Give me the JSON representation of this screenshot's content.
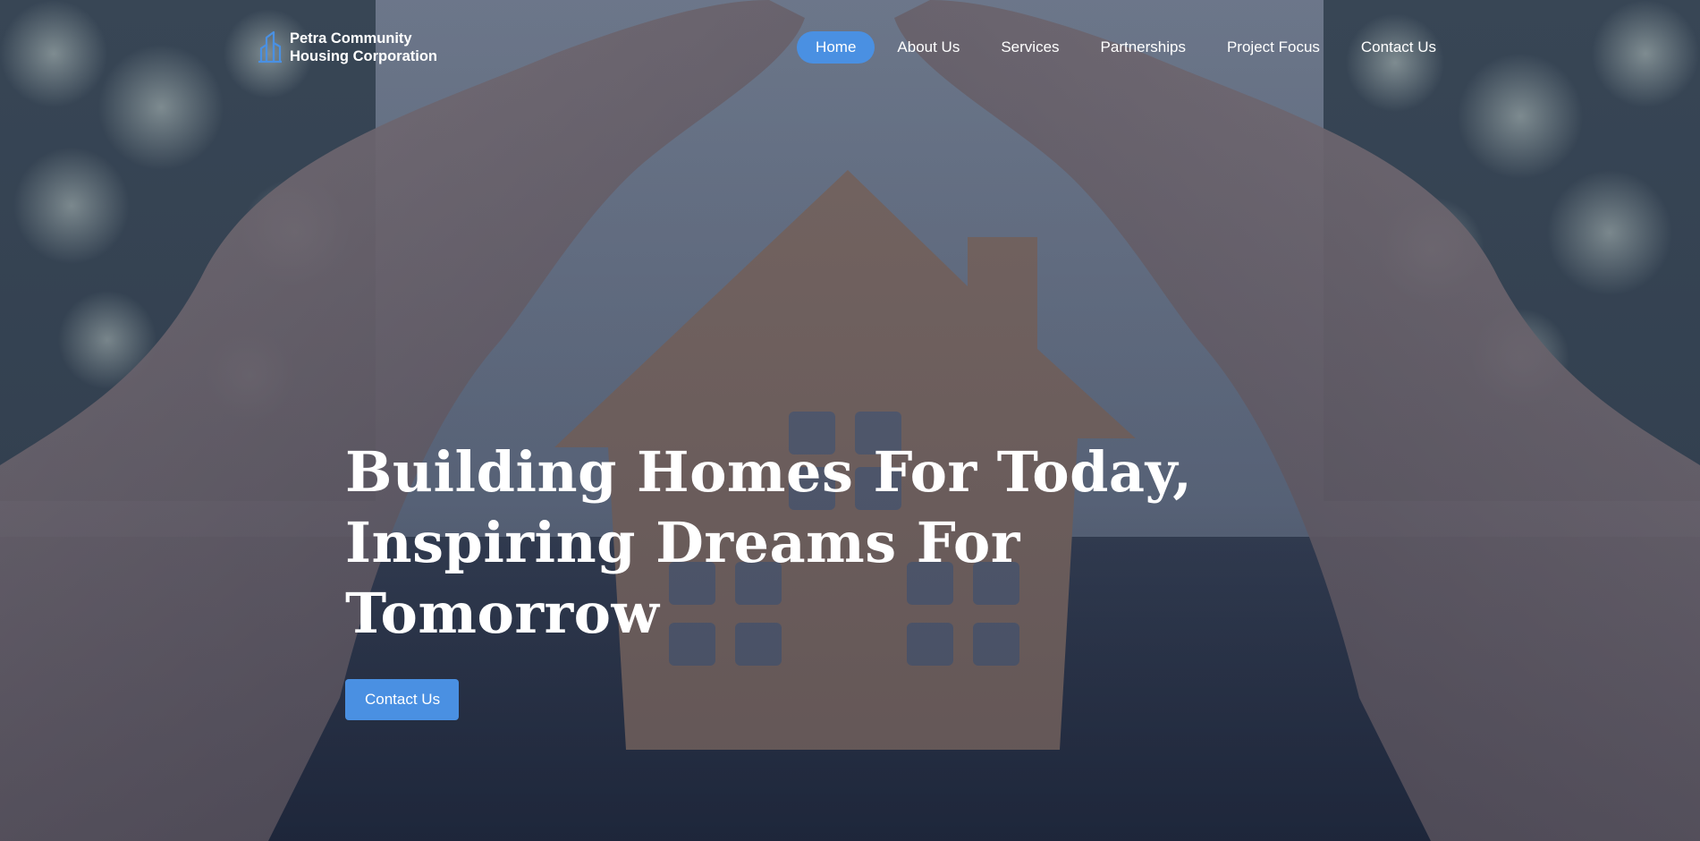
{
  "brand": {
    "name_line1": "Petra Community",
    "name_line2": "Housing Corporation",
    "logo_icon": "building-icon",
    "accent_color": "#4a90e2"
  },
  "nav": {
    "items": [
      {
        "label": "Home",
        "active": true
      },
      {
        "label": "About Us",
        "active": false
      },
      {
        "label": "Services",
        "active": false
      },
      {
        "label": "Partnerships",
        "active": false
      },
      {
        "label": "Project Focus",
        "active": false
      },
      {
        "label": "Contact Us",
        "active": false
      }
    ]
  },
  "hero": {
    "title_lines": [
      "Building Homes For Today,",
      "Inspiring Dreams For",
      "Tomorrow"
    ],
    "cta_label": "Contact Us",
    "background_image": "hands-sheltering-wooden-house-photo"
  }
}
